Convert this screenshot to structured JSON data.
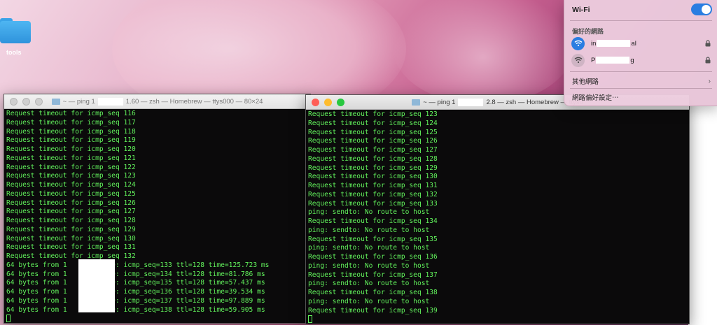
{
  "desktop": {
    "folder_label": "tools"
  },
  "window1": {
    "title_prefix": "~ — ping 1",
    "title_suffix": "1.60 — zsh — Homebrew — ttys000 — 80×24",
    "lines": [
      "Request timeout for icmp_seq 116",
      "Request timeout for icmp_seq 117",
      "Request timeout for icmp_seq 118",
      "Request timeout for icmp_seq 119",
      "Request timeout for icmp_seq 120",
      "Request timeout for icmp_seq 121",
      "Request timeout for icmp_seq 122",
      "Request timeout for icmp_seq 123",
      "Request timeout for icmp_seq 124",
      "Request timeout for icmp_seq 125",
      "Request timeout for icmp_seq 126",
      "Request timeout for icmp_seq 127",
      "Request timeout for icmp_seq 128",
      "Request timeout for icmp_seq 129",
      "Request timeout for icmp_seq 130",
      "Request timeout for icmp_seq 131",
      "Request timeout for icmp_seq 132",
      "64 bytes from 1        1.60: icmp_seq=133 ttl=128 time=125.723 ms",
      "64 bytes from 1        1.60: icmp_seq=134 ttl=128 time=81.786 ms",
      "64 bytes from 1        1.60: icmp_seq=135 ttl=128 time=57.437 ms",
      "64 bytes from 1        1.60: icmp_seq=136 ttl=128 time=39.534 ms",
      "64 bytes from 1        1.60: icmp_seq=137 ttl=128 time=97.889 ms",
      "64 bytes from 1        1.60: icmp_seq=138 ttl=128 time=59.905 ms"
    ]
  },
  "window2": {
    "title_prefix": "~ — ping 1",
    "title_suffix": "2.8 — zsh — Homebrew — ttys0",
    "lines": [
      "Request timeout for icmp_seq 123",
      "Request timeout for icmp_seq 124",
      "Request timeout for icmp_seq 125",
      "Request timeout for icmp_seq 126",
      "Request timeout for icmp_seq 127",
      "Request timeout for icmp_seq 128",
      "Request timeout for icmp_seq 129",
      "Request timeout for icmp_seq 130",
      "Request timeout for icmp_seq 131",
      "Request timeout for icmp_seq 132",
      "Request timeout for icmp_seq 133",
      "ping: sendto: No route to host",
      "Request timeout for icmp_seq 134",
      "ping: sendto: No route to host",
      "Request timeout for icmp_seq 135",
      "ping: sendto: No route to host",
      "Request timeout for icmp_seq 136",
      "ping: sendto: No route to host",
      "Request timeout for icmp_seq 137",
      "ping: sendto: No route to host",
      "Request timeout for icmp_seq 138",
      "ping: sendto: No route to host",
      "Request timeout for icmp_seq 139"
    ]
  },
  "wifi_menu": {
    "title": "Wi-Fi",
    "toggle_on": true,
    "section_title": "偏好的網路",
    "networks": [
      {
        "prefix": "in",
        "suffix": "al",
        "connected": true
      },
      {
        "prefix": "P",
        "suffix": "g",
        "connected": false
      }
    ],
    "other_networks": "其他網路",
    "settings": "網路偏好設定⋯",
    "accent": "#2a7de1"
  }
}
